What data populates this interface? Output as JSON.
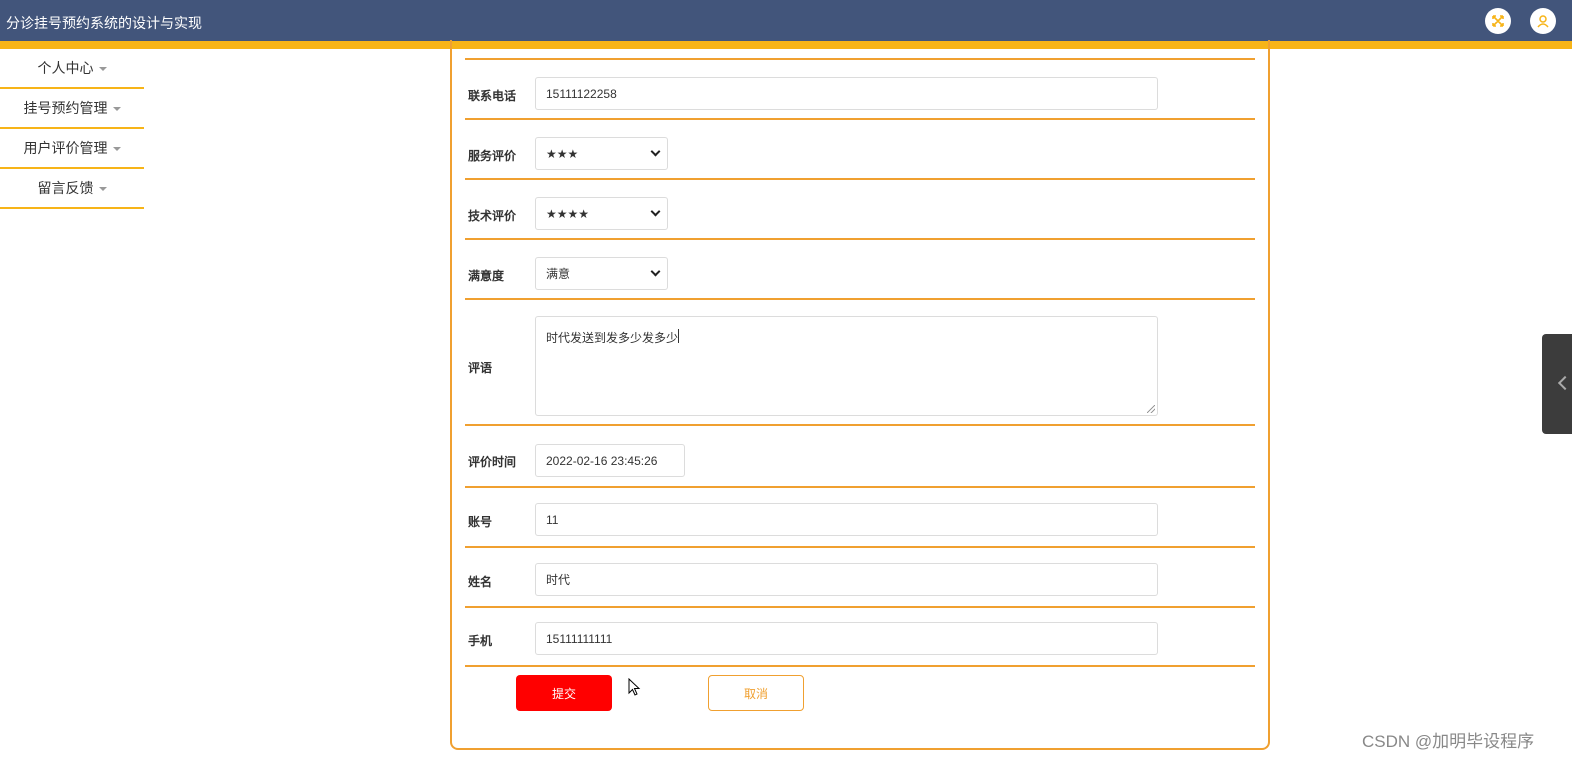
{
  "app": {
    "title": "分诊挂号预约系统的设计与实现"
  },
  "sidebar": {
    "items": [
      {
        "label": "个人中心"
      },
      {
        "label": "挂号预约管理"
      },
      {
        "label": "用户评价管理"
      },
      {
        "label": "留言反馈"
      }
    ]
  },
  "form": {
    "phone": {
      "label": "联系电话",
      "value": "15111122258"
    },
    "service_rating": {
      "label": "服务评价",
      "value": "★★★"
    },
    "tech_rating": {
      "label": "技术评价",
      "value": "★★★★"
    },
    "satisfaction": {
      "label": "满意度",
      "value": "满意"
    },
    "comment": {
      "label": "评语",
      "value": "时代发送到发多少发多少"
    },
    "review_time": {
      "label": "评价时间",
      "value": "2022-02-16 23:45:26"
    },
    "account": {
      "label": "账号",
      "value": "11"
    },
    "name": {
      "label": "姓名",
      "value": "时代"
    },
    "mobile": {
      "label": "手机",
      "value": "15111111111"
    }
  },
  "buttons": {
    "submit": "提交",
    "cancel": "取消"
  },
  "watermark": "CSDN @加明毕设程序",
  "colors": {
    "topbar": "#42557b",
    "accent": "#f7b418",
    "border": "#f0a030",
    "submit": "#ff0000"
  }
}
